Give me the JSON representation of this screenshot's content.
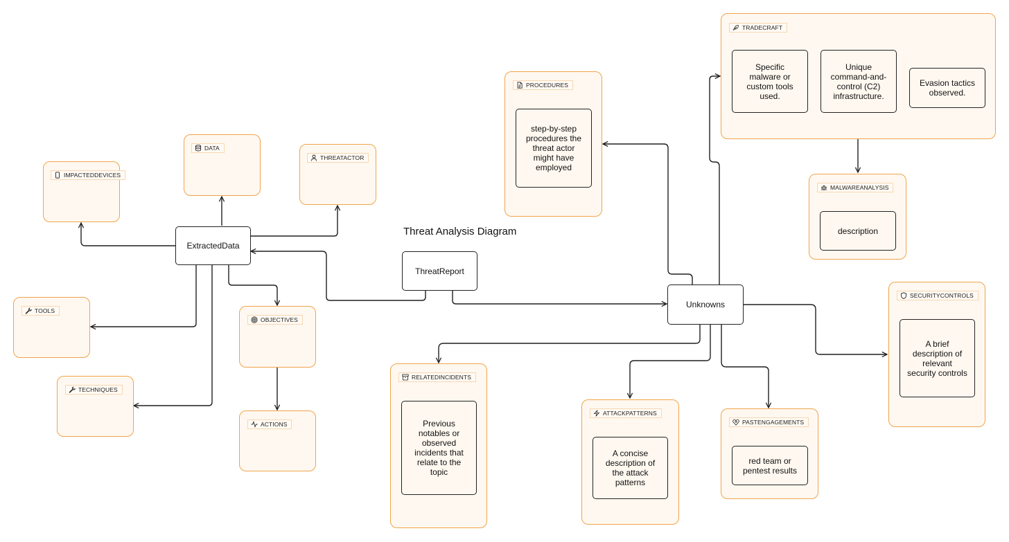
{
  "title": "Threat Analysis Diagram",
  "colors": {
    "group_border": "#f0a44b",
    "group_fill": "#fff8f0",
    "edge": "#1f1f1f"
  },
  "nodes": {
    "extracted_data": "ExtractedData",
    "threat_report": "ThreatReport",
    "unknowns": "Unknowns"
  },
  "groups": {
    "impacted_devices": {
      "label": "IMPACTEDDEVICES",
      "icon": "tablet-icon"
    },
    "data": {
      "label": "DATA",
      "icon": "database-icon"
    },
    "threat_actor": {
      "label": "THREATACTOR",
      "icon": "user-icon"
    },
    "tools": {
      "label": "TOOLS",
      "icon": "wrench-icon"
    },
    "techniques": {
      "label": "TECHNIQUES",
      "icon": "wrench-icon"
    },
    "objectives": {
      "label": "OBJECTIVES",
      "icon": "target-icon"
    },
    "actions": {
      "label": "ACTIONS",
      "icon": "activity-icon"
    },
    "procedures": {
      "label": "PROCEDURES",
      "icon": "file-icon",
      "items": [
        "step-by-step procedures the threat actor might have employed"
      ]
    },
    "tradecraft": {
      "label": "TRADECRAFT",
      "icon": "feather-icon",
      "items": [
        "Specific malware or custom tools used.",
        "Unique command-and-control (C2) infrastructure.",
        "Evasion tactics observed."
      ]
    },
    "malware_analysis": {
      "label": "MALWAREANALYSIS",
      "icon": "bug-icon",
      "items": [
        "description"
      ]
    },
    "security_controls": {
      "label": "SECURITYCONTROLS",
      "icon": "shield-icon",
      "items": [
        "A brief description of relevant security controls"
      ]
    },
    "related_incidents": {
      "label": "RELATEDINCIDENTS",
      "icon": "archive-icon",
      "items": [
        "Previous notables or observed incidents that relate to the topic"
      ]
    },
    "attack_patterns": {
      "label": "ATTACKPATTERNS",
      "icon": "zap-icon",
      "items": [
        "A concise description of the attack patterns"
      ]
    },
    "past_engagements": {
      "label": "PASTENGAGEMENTS",
      "icon": "heart-handshake-icon",
      "items": [
        "red team or pentest results"
      ]
    }
  },
  "edges": [
    {
      "from": "ThreatReport",
      "to": "ExtractedData"
    },
    {
      "from": "ThreatReport",
      "to": "Unknowns"
    },
    {
      "from": "ExtractedData",
      "to": "IMPACTEDDEVICES"
    },
    {
      "from": "ExtractedData",
      "to": "DATA"
    },
    {
      "from": "ExtractedData",
      "to": "THREATACTOR"
    },
    {
      "from": "ExtractedData",
      "to": "TOOLS"
    },
    {
      "from": "ExtractedData",
      "to": "TECHNIQUES"
    },
    {
      "from": "ExtractedData",
      "to": "OBJECTIVES"
    },
    {
      "from": "OBJECTIVES",
      "to": "ACTIONS"
    },
    {
      "from": "Unknowns",
      "to": "PROCEDURES"
    },
    {
      "from": "Unknowns",
      "to": "TRADECRAFT"
    },
    {
      "from": "TRADECRAFT",
      "to": "MALWAREANALYSIS"
    },
    {
      "from": "Unknowns",
      "to": "SECURITYCONTROLS"
    },
    {
      "from": "Unknowns",
      "to": "RELATEDINCIDENTS"
    },
    {
      "from": "Unknowns",
      "to": "ATTACKPATTERNS"
    },
    {
      "from": "Unknowns",
      "to": "PASTENGAGEMENTS"
    }
  ]
}
